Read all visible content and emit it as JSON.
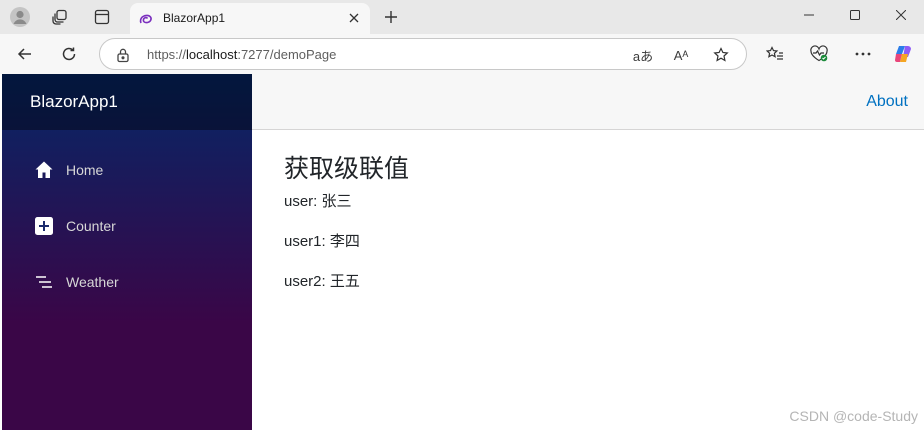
{
  "browser": {
    "tab_title": "BlazorApp1",
    "url_prefix": "https://",
    "url_host": "localhost",
    "url_path": ":7277/demoPage",
    "read_aloud_label": "Aᴬ",
    "translate_label": "aあ"
  },
  "app": {
    "brand": "BlazorApp1",
    "top_link": "About",
    "nav": [
      {
        "label": "Home",
        "icon": "house-icon"
      },
      {
        "label": "Counter",
        "icon": "plus-square-icon"
      },
      {
        "label": "Weather",
        "icon": "list-nested-icon"
      }
    ]
  },
  "content": {
    "heading": "获取级联值",
    "lines": [
      {
        "key": "user:",
        "value": "张三"
      },
      {
        "key": "user1:",
        "value": "李四"
      },
      {
        "key": "user2:",
        "value": "王五"
      }
    ]
  },
  "watermark": "CSDN @code-Study",
  "colors": {
    "sidebar_top": "#052767",
    "sidebar_bottom": "#3a0647",
    "link": "#0071c1"
  }
}
